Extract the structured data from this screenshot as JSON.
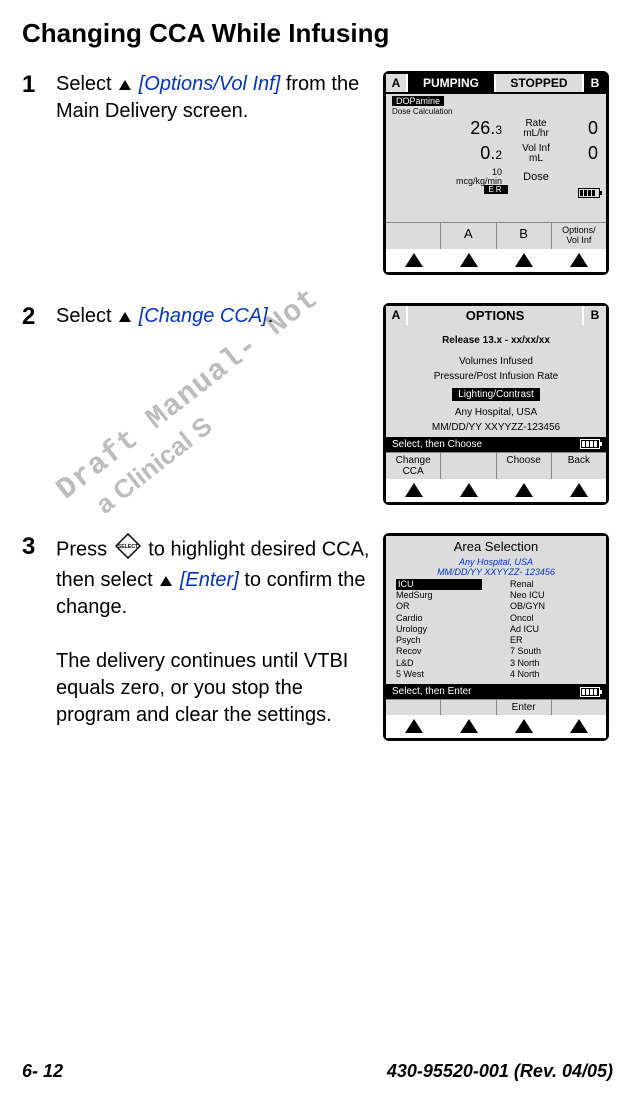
{
  "title": "Changing CCA While Infusing",
  "steps": {
    "s1": {
      "num": "1",
      "pre": "Select ",
      "ref": "[Options/Vol Inf]",
      "post": " from the Main Delivery screen."
    },
    "s2": {
      "num": "2",
      "pre": "Select ",
      "ref": "[Change CCA]",
      "post": "."
    },
    "s3": {
      "num": "3",
      "pre": "Press ",
      "mid": " to highlight desired CCA, then select ",
      "ref": "[Enter]",
      "post": " to confirm the change.",
      "para2": "The delivery continues until VTBI equals zero, or you stop the program and clear the settings."
    }
  },
  "screen1": {
    "tabA": "A",
    "tabPump": "PUMPING",
    "tabStop": "STOPPED",
    "tabB": "B",
    "dop": "DOPamine",
    "calc": "Dose Calculation",
    "rate_val": "26.",
    "rate_val_sm": "3",
    "rate_lbl1": "Rate",
    "rate_lbl2": "mL/hr",
    "rate_zero": "0",
    "vol_val": "0.",
    "vol_val_sm": "2",
    "vol_lbl1": "Vol Inf",
    "vol_lbl2": "mL",
    "vol_zero": "0",
    "dose_top": "10",
    "dose_bot": "mcg/kg/min",
    "dose_lbl": "Dose",
    "er": "ER",
    "foot_a": "A",
    "foot_b": "B",
    "foot_opt1": "Options/",
    "foot_opt2": "Vol Inf"
  },
  "screen2": {
    "tabA": "A",
    "title": "OPTIONS",
    "tabB": "B",
    "release": "Release 13.x - xx/xx/xx",
    "row1": "Volumes Infused",
    "row2": "Pressure/Post Infusion Rate",
    "hl": "Lighting/Contrast",
    "hosp1": "Any Hospital, USA",
    "hosp2": "MM/DD/YY XXYYZZ-123456",
    "selrow": "Select, then Choose",
    "foot1a": "Change",
    "foot1b": "CCA",
    "foot3": "Choose",
    "foot4": "Back"
  },
  "screen3": {
    "title": "Area Selection",
    "hosp1": "Any Hospital, USA",
    "hosp2": "MM/DD/YY XXYYZZ- 123456",
    "colA": [
      "ICU",
      "MedSurg",
      "OR",
      "Cardio",
      "Urology",
      "Psych",
      "Recov",
      "L&D",
      "5 West"
    ],
    "colB": [
      "Renal",
      "Neo ICU",
      "OB/GYN",
      "Oncol",
      "Ad ICU",
      "ER",
      "7 South",
      "3 North",
      "4 North"
    ],
    "selrow": "Select, then Enter",
    "foot3": "Enter"
  },
  "watermark": {
    "l1": "Draft Manual- Not",
    "l2": "   a Clinical S"
  },
  "footer": {
    "page": "6- 12",
    "doc": "430-95520-001 (Rev. 04/05)"
  }
}
